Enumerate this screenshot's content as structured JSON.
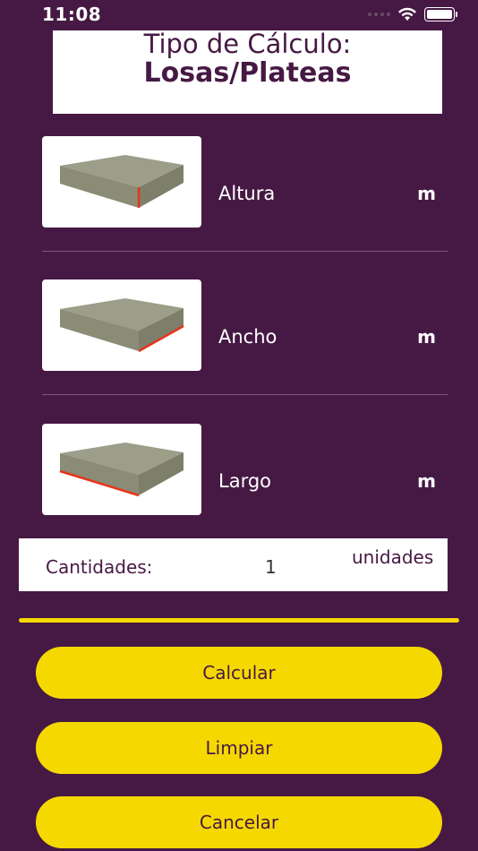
{
  "status": {
    "time": "11:08"
  },
  "header": {
    "title": "Tipo de Cálculo:",
    "subtitle": "Losas/Plateas"
  },
  "fields": [
    {
      "label": "Altura",
      "unit": "m",
      "highlight": "height"
    },
    {
      "label": "Ancho",
      "unit": "m",
      "highlight": "width"
    },
    {
      "label": "Largo",
      "unit": "m",
      "highlight": "length"
    }
  ],
  "quantity": {
    "label": "Cantidades:",
    "value": "1",
    "unit": "unidades"
  },
  "buttons": {
    "calculate": "Calcular",
    "clear": "Limpiar",
    "cancel": "Cancelar"
  },
  "colors": {
    "background": "#461944",
    "accent": "#f5d800",
    "edge": "#e8341c"
  }
}
